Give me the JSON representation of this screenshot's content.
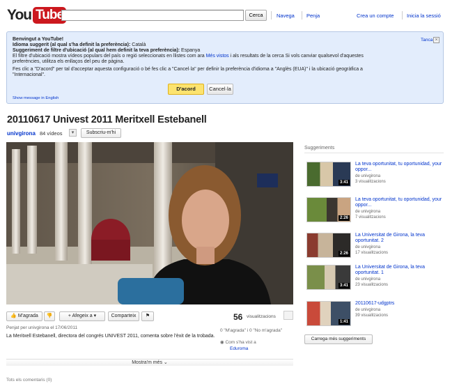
{
  "header": {
    "logo_you": "You",
    "logo_tube": "Tube",
    "search_button": "Cerca",
    "nav": [
      "Navega",
      "Penja"
    ],
    "create_account": "Crea un compte",
    "sign_in": "Inicia la sessió"
  },
  "notice": {
    "welcome": "Benvingut a YouTube!",
    "lang_label": "Idioma suggerit (al qual s'ha definit la preferència):",
    "lang_value": " Català",
    "loc_label": "Suggeriment de filtre d'ubicació (al qual hem definit la teva preferència):",
    "loc_value": " Espanya",
    "line4_a": "El filtre d'ubicació mostra vídeos populars del país o regió seleccionats en llistes com ara ",
    "line4_link": "Més vistos",
    "line4_b": " i als resultats de la cerca Si vols canviar qualsevol d'aquestes",
    "line5": "preferències, utilitza els enllaços del peu de pàgina.",
    "line6": "Fes clic a \"D'acord\" per tal d'acceptar aquesta configuració o bé fes clic a \"Cancel·la\" per definir la preferència d'idioma a \"Anglès (EUA)\" i la ubicació geogràfica a",
    "line7": "\"Internacional\".",
    "close_label": "Tanca",
    "accept_button": "D'acord",
    "cancel_button": "Cancel·la",
    "english_link": "Show message in English"
  },
  "video": {
    "title": "20110617 Univest 2011 Meritxell Estebanell",
    "channel": "univgirona",
    "video_count": "84 vídeos",
    "subscribe": "Subscriu-m'hi",
    "like_button": "M'agrada",
    "add_button": "Afegeix a",
    "share_button": "Comparteix",
    "views_number": "56",
    "views_label": "visualitzacions",
    "uploader": "Penjat per univgirona el 17/06/2011",
    "description": "La Meritxell Estebanell, directora del congrés UNIVEST 2011, comenta sobre l'èxit de la trobada.",
    "likes": "0 \"M'agrada\" i 0 \"No m'agrada\"",
    "seen_at": "Com s'ha vist a",
    "seen_source": "Eduroma",
    "show_more": "Mostra'm més",
    "comments": "Tots els comentaris (0)"
  },
  "sidebar": {
    "title": "Suggeriments",
    "items": [
      {
        "title": "La teva oportunitat, tu oportunidad, your oppor...",
        "by": "de univgirona",
        "views": "3 visualitzacions",
        "duration": "3:41"
      },
      {
        "title": "La teva oportunitat, tu oportunidad, your oppor...",
        "by": "de univgirona",
        "views": "7 visualitzacions",
        "duration": "2:26"
      },
      {
        "title": "La Universitat de Girona, la teva oportunitat. 2",
        "by": "de univgirona",
        "views": "17 visualitzacions",
        "duration": "2:26"
      },
      {
        "title": "La Universitat de Girona, la teva oportunitat. 1",
        "by": "de univgirona",
        "views": "23 visualitzacions",
        "duration": "3:41"
      },
      {
        "title": "20110617-udgptrs",
        "by": "de univgirona",
        "views": "39 visualitzacions",
        "duration": "1:41"
      }
    ],
    "more_button": "Carrega més suggeriments"
  }
}
